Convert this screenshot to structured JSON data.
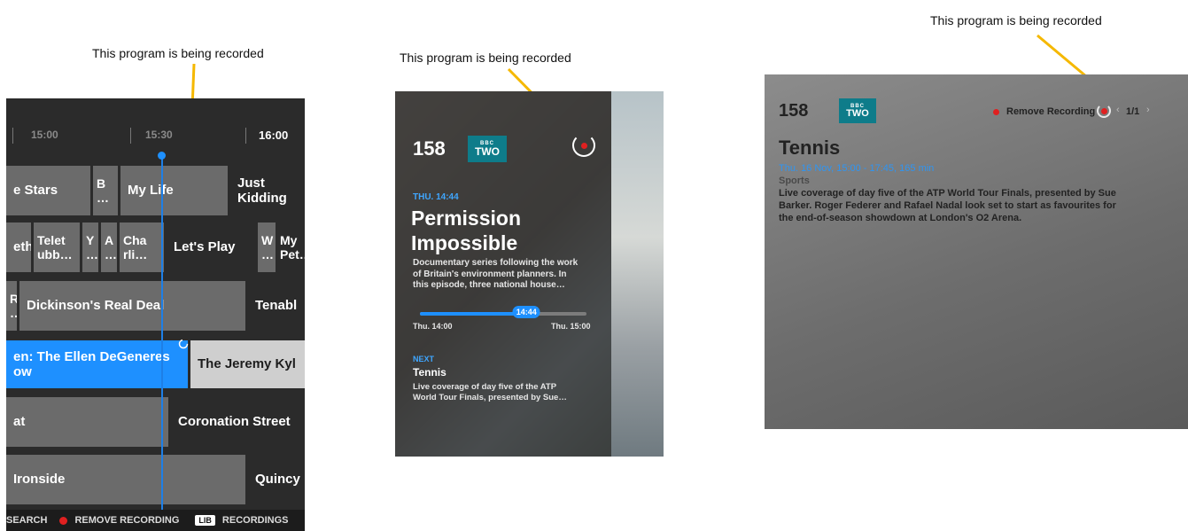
{
  "callouts": {
    "panel1": "This program is being recorded",
    "panel2": "This program is being recorded",
    "panel3": "This program is being recorded"
  },
  "colors": {
    "accent": "#1e90ff",
    "record": "#e02020",
    "callout_line": "#f5b800",
    "channel_logo": "#0e7c8a"
  },
  "epg": {
    "times": [
      "15:00",
      "15:30",
      "16:00"
    ],
    "rows": [
      [
        "e Stars",
        "B …",
        "My Life",
        "Just Kidding"
      ],
      [
        "eth",
        "Telet ubb…",
        "Y …",
        "A …",
        "Cha rli…",
        "Let's Play",
        "W …",
        "My Pet…"
      ],
      [
        "R …",
        "Dickinson's Real Deal",
        "Tenabl"
      ],
      [
        "en: The Ellen DeGeneres ow",
        "The Jeremy Kyl"
      ],
      [
        "at",
        "Coronation Street"
      ],
      [
        "Ironside",
        "Quincy"
      ]
    ],
    "footer": {
      "search": "SEARCH",
      "remove_recording": "REMOVE RECORDING",
      "lib": "LIB",
      "recordings": "RECORDINGS"
    }
  },
  "info": {
    "channel_number": "158",
    "channel_logo_top": "BBC",
    "channel_logo": "TWO",
    "time_label": "THU. 14:44",
    "title_line1": "Permission",
    "title_line2": "Impossible",
    "desc_line1": "Documentary series following the work",
    "desc_line2": "of Britain's environment planners. In",
    "desc_line3": "this episode, three national house…",
    "progress": 0.64,
    "progress_label": "14:44",
    "start": "Thu. 14:00",
    "end": "Thu. 15:00",
    "next_label": "NEXT",
    "next_title": "Tennis",
    "next_desc_line1": "Live coverage of day five of the ATP",
    "next_desc_line2": "World Tour Finals, presented by Sue…"
  },
  "detail": {
    "channel_number": "158",
    "channel_logo_top": "BBC",
    "channel_logo": "TWO",
    "remove_recording": "Remove Recording",
    "page": "1/1",
    "title": "Tennis",
    "schedule": "Thu. 16 Nov, 15:00 - 17:45, 165 min",
    "genre": "Sports",
    "desc_line1": "Live coverage of day five of the ATP World Tour Finals, presented by Sue",
    "desc_line2": "Barker. Roger Federer and Rafael Nadal look set to start as favourites for",
    "desc_line3": "the end-of-season showdown at London's O2 Arena."
  }
}
